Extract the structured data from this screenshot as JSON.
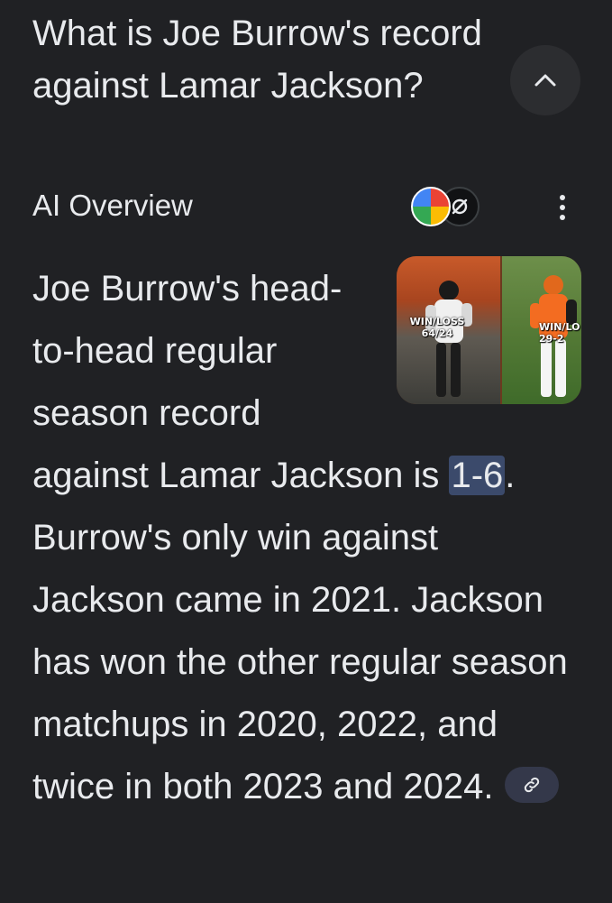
{
  "question": {
    "text": "What is Joe Burrow's record against Lamar Jackson?"
  },
  "overview": {
    "label": "AI Overview"
  },
  "thumbnail": {
    "left_caption": "WIN/LOSS\n64/24",
    "right_caption": "WIN/LO\n29-2"
  },
  "answer": {
    "part1": "Joe Burrow's head-to-head regular season record against Lamar Jackson is ",
    "line1": "Joe Burrow's head-",
    "line2": "to-head regular",
    "line3": "season record",
    "line4_pre": "against Lamar Jackson is ",
    "record": "1-6",
    "rest": ". Burrow's only win against Jackson came in 2021. Jackson has won the other regular season matchups in 2020, 2022, and twice in both 2023 and 2024."
  },
  "icons": {
    "collapse": "chevron-up-icon",
    "more": "more-vert-icon",
    "link": "link-icon",
    "badge_a": "gemini-badge-icon",
    "badge_b": "source-badge-icon"
  },
  "colors": {
    "background": "#202124",
    "text": "#e8eaed",
    "highlight": "#3b4a6b",
    "chip": "#34384a"
  }
}
